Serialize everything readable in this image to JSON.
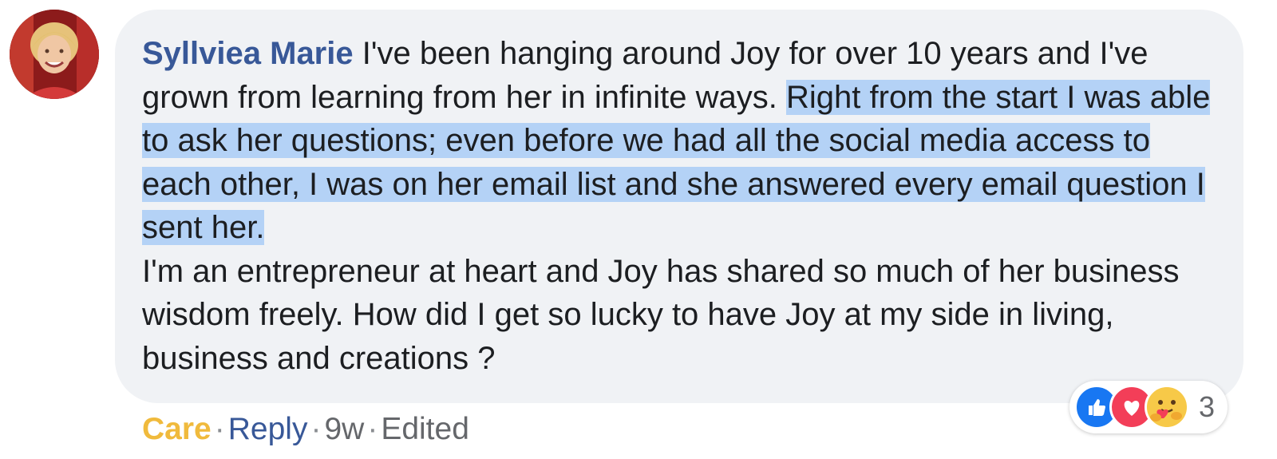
{
  "comment": {
    "author": "Syllviea Marie",
    "text_before": "I've been hanging around Joy for over 10 years and I've grown from learning from her in infinite ways.",
    "text_highlighted": "Right from the start I was able to ask her questions; even before we had all the social media access to each other, I was on her email list and she answered every email question I sent her.",
    "text_after": "I'm an entrepreneur at heart and Joy has shared so much of her business wisdom freely. How did I get so lucky to have Joy at my side in living, business and creations ?"
  },
  "actions": {
    "care_label": "Care",
    "separator": "·",
    "reply_label": "Reply",
    "time": "9w",
    "edited_label": "Edited"
  },
  "reactions": {
    "types": [
      "like-icon",
      "love-icon",
      "care-icon"
    ],
    "count": "3"
  },
  "colors": {
    "author": "#385898",
    "care": "#f0ba3c",
    "highlight": "#b4d2f6",
    "bubble": "#f0f2f5"
  }
}
